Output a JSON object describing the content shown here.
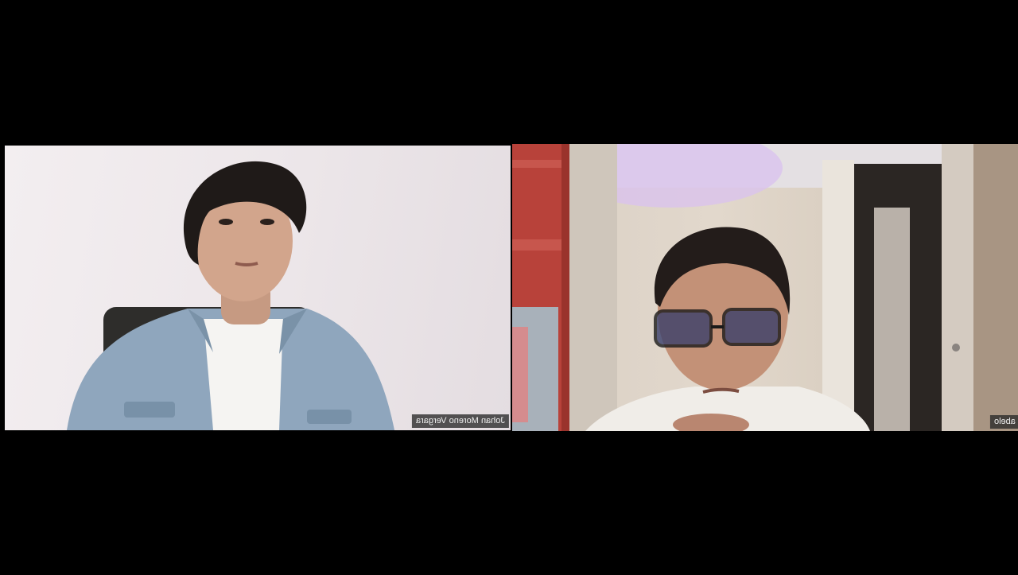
{
  "meeting": {
    "participants": [
      {
        "display_name": "Johan Moreno Vergara",
        "mirrored": true
      },
      {
        "display_name": "abelo",
        "mirrored": true
      }
    ]
  },
  "colors": {
    "background": "#000000",
    "tile1_wall": "#efe9ec",
    "tile2_wall": "#ddd3c7",
    "shelf_red": "#b8423a"
  }
}
